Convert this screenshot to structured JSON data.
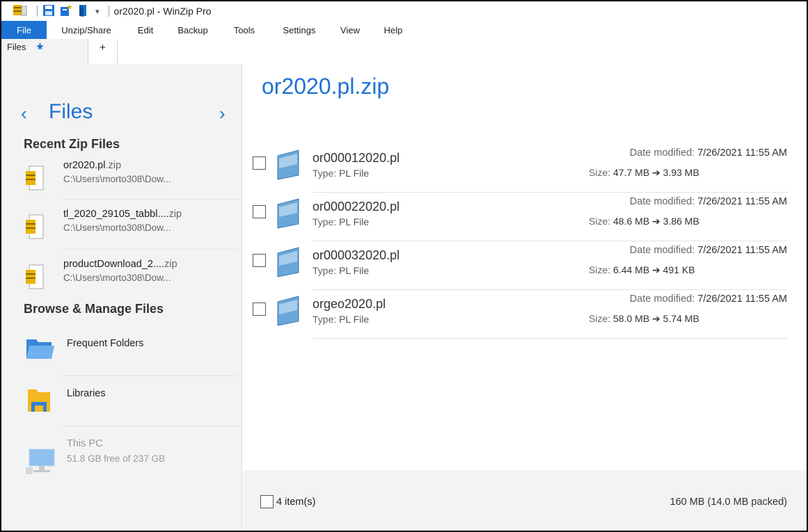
{
  "window": {
    "title": "or2020.pl - WinZip Pro",
    "qat_icons": [
      "winzip-icon",
      "save-icon",
      "new-zip-icon",
      "open-zip-icon",
      "customize-qat-icon"
    ],
    "qat_dropdown": "▾"
  },
  "menu": {
    "items": [
      "File",
      "Unzip/Share",
      "Edit",
      "Backup",
      "Tools",
      "Settings",
      "View",
      "Help"
    ]
  },
  "left_panel": {
    "tab_files": "Files",
    "tab_add": "+",
    "nav_back": "‹",
    "nav_title": "Files",
    "nav_forward": "›",
    "recent_heading": "Recent Zip Files",
    "recent": [
      {
        "name": "or2020.pl",
        "ext": ".zip",
        "path": "C:\\Users\\morto308\\Dow..."
      },
      {
        "name": "tl_2020_29105_tabbl....",
        "ext": "zip",
        "path": "C:\\Users\\morto308\\Dow..."
      },
      {
        "name": "productDownload_2....",
        "ext": "zip",
        "path": "C:\\Users\\morto308\\Dow..."
      }
    ],
    "browse_heading": "Browse & Manage Files",
    "browse": [
      {
        "label": "Frequent Folders",
        "sub": ""
      },
      {
        "label": "Libraries",
        "sub": ""
      },
      {
        "label": "This PC",
        "sub": "51.8 GB free of 237 GB"
      }
    ]
  },
  "content": {
    "zip_title": "or2020.pl.zip",
    "date_label": "Date modified:",
    "size_label": "Size:",
    "type_label": "Type:",
    "arrow": "➔",
    "files": [
      {
        "name": "or000012020.pl",
        "type": "PL File",
        "date": "7/26/2021 11:55 AM",
        "size": "47.7 MB",
        "packed": "3.93 MB"
      },
      {
        "name": "or000022020.pl",
        "type": "PL File",
        "date": "7/26/2021 11:55 AM",
        "size": "48.6 MB",
        "packed": "3.86 MB"
      },
      {
        "name": "or000032020.pl",
        "type": "PL File",
        "date": "7/26/2021 11:55 AM",
        "size": "6.44 MB",
        "packed": "491 KB"
      },
      {
        "name": "orgeo2020.pl",
        "type": "PL File",
        "date": "7/26/2021 11:55 AM",
        "size": "58.0 MB",
        "packed": "5.74 MB"
      }
    ],
    "footer": {
      "count": "4 item(s)",
      "total": "160 MB (14.0 MB packed)"
    }
  },
  "colors": {
    "accent": "#1e73d2",
    "panel_bg": "#f3f3f3"
  }
}
